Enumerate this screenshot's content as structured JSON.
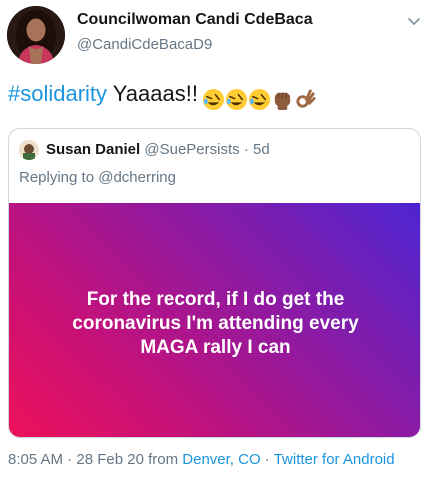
{
  "author": {
    "display_name": "Councilwoman Candi CdeBaca",
    "handle": "@CandiCdeBacaD9"
  },
  "tweet": {
    "hashtag": "#solidarity",
    "text": " Yaaaas!!",
    "emojis": [
      "rolling-on-floor-laughing",
      "rolling-on-floor-laughing",
      "rolling-on-floor-laughing",
      "raised-fist-medium-dark",
      "ok-hand-medium-dark"
    ]
  },
  "quoted": {
    "name": "Susan Daniel",
    "handle": "@SuePersists",
    "age": "· 5d",
    "replying_to": "Replying to @dcherring",
    "image_text": "For the record, if I do get the\ncoronavirus I'm attending every\nMAGA rally I can"
  },
  "meta": {
    "time": "8:05 AM · 28 Feb 20 from ",
    "location": "Denver, CO",
    "separator": " · ",
    "client": "Twitter for Android"
  },
  "colors": {
    "link": "#1b95e0",
    "muted": "#657786",
    "text": "#14171a"
  }
}
